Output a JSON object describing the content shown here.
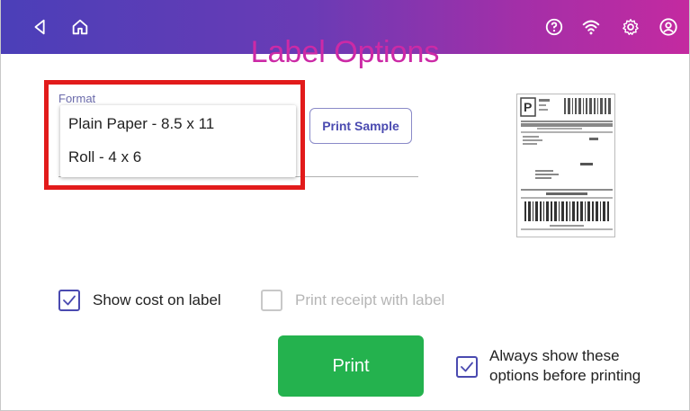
{
  "page": {
    "title": "Label Options"
  },
  "topbar": {
    "icons": [
      "back-icon",
      "home-icon",
      "help-icon",
      "wifi-icon",
      "settings-icon",
      "account-icon"
    ],
    "gradient_start": "#4b3fb8",
    "gradient_end": "#c42aa0"
  },
  "format": {
    "label": "Format",
    "options": [
      "Plain Paper - 8.5 x 11",
      "Roll - 4 x 6"
    ]
  },
  "print_sample": {
    "label": "Print Sample"
  },
  "options": {
    "show_cost": {
      "label": "Show cost on label",
      "checked": true
    },
    "print_receipt": {
      "label": "Print receipt with label",
      "checked": false,
      "disabled": true
    },
    "always_show": {
      "label_line1": "Always show these",
      "label_line2": "options before printing",
      "checked": true
    }
  },
  "print_button": {
    "label": "Print",
    "color": "#24b24e"
  },
  "colors": {
    "title": "#cc2aa6",
    "accent": "#4a4ab0",
    "highlight": "#e21b1b"
  }
}
